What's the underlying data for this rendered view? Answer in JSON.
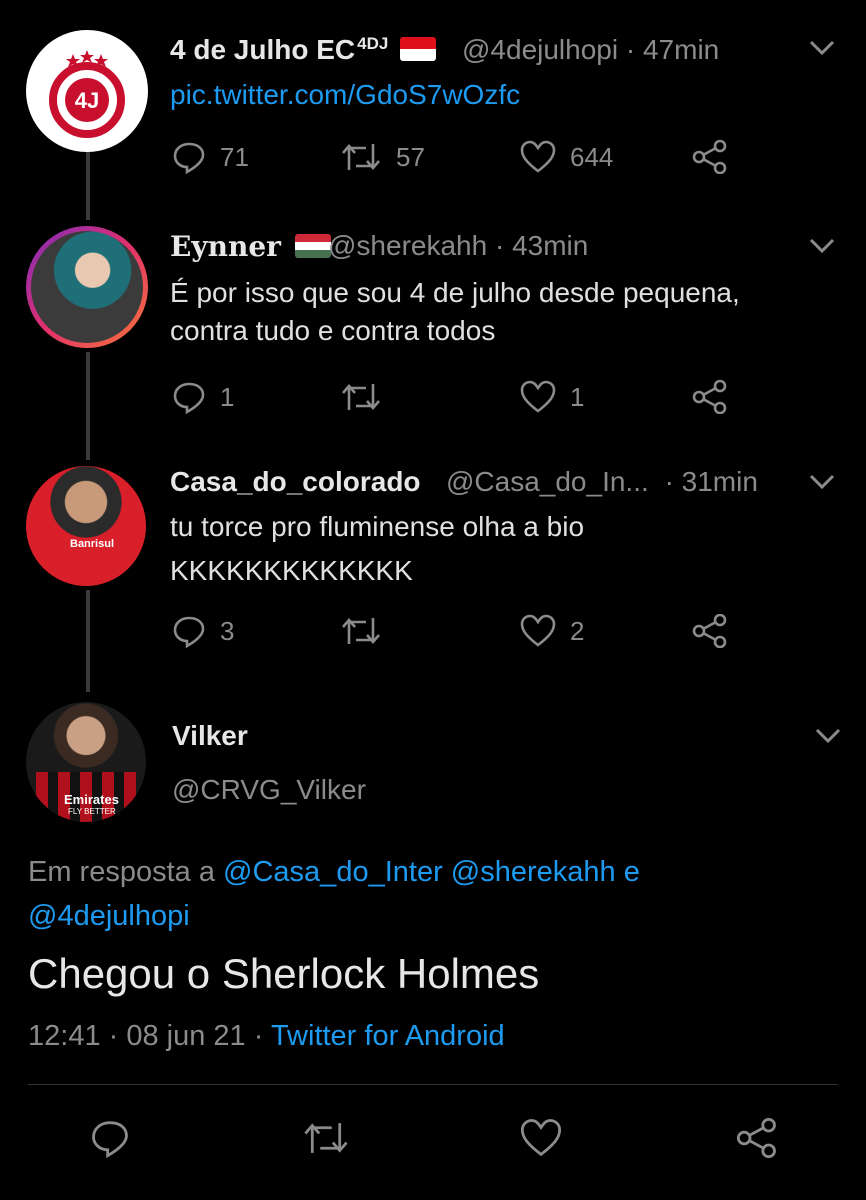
{
  "tweets": [
    {
      "name": "4 de Julho EC",
      "name_sup": "4DJ",
      "handle": "@4dejulhopi",
      "time": "· 47min",
      "text": "pic.twitter.com/GdoS7wOzfc",
      "replies": "71",
      "retweets": "57",
      "likes": "644",
      "badge": {
        "crest_top": "4 DE JULHO ESPORTE CLUBE",
        "crest_bottom": "PIRIPIRI-PI",
        "mono": "4J"
      }
    },
    {
      "name": "Eynner",
      "handle": "@sherekahh",
      "time": "· 43min",
      "text_lines": [
        "É por isso que sou 4 de julho desde pequena,",
        "contra tudo e contra todos"
      ],
      "replies": "1",
      "likes": "1"
    },
    {
      "name": "Casa_do_colorado",
      "handle": "@Casa_do_In...",
      "time": "· 31min",
      "text_lines": [
        "tu torce pro fluminense olha a bio",
        "KKKKKKKKKKKKK"
      ],
      "replies": "3",
      "likes": "2",
      "shirt_text": "Banrisul"
    }
  ],
  "focused": {
    "name": "Vilker",
    "handle": "@CRVG_Vilker",
    "reply_prefix": "Em resposta a",
    "reply_mentions_1": "@Casa_do_Inter @sherekahh e",
    "reply_mentions_2": "@4dejulhopi",
    "text": "Chegou o Sherlock Holmes",
    "time": "12:41 · 08 jun 21 ·",
    "source": "Twitter for Android",
    "shirt_text_1": "Emirates",
    "shirt_text_2": "FLY BETTER"
  },
  "colors": {
    "background": "#000000",
    "link": "#1d9bf0",
    "muted": "#8b8b8b",
    "thread_line": "#3a3a3a"
  },
  "icons": [
    "reply-icon",
    "retweet-icon",
    "like-icon",
    "share-icon",
    "chevron-down-icon"
  ]
}
